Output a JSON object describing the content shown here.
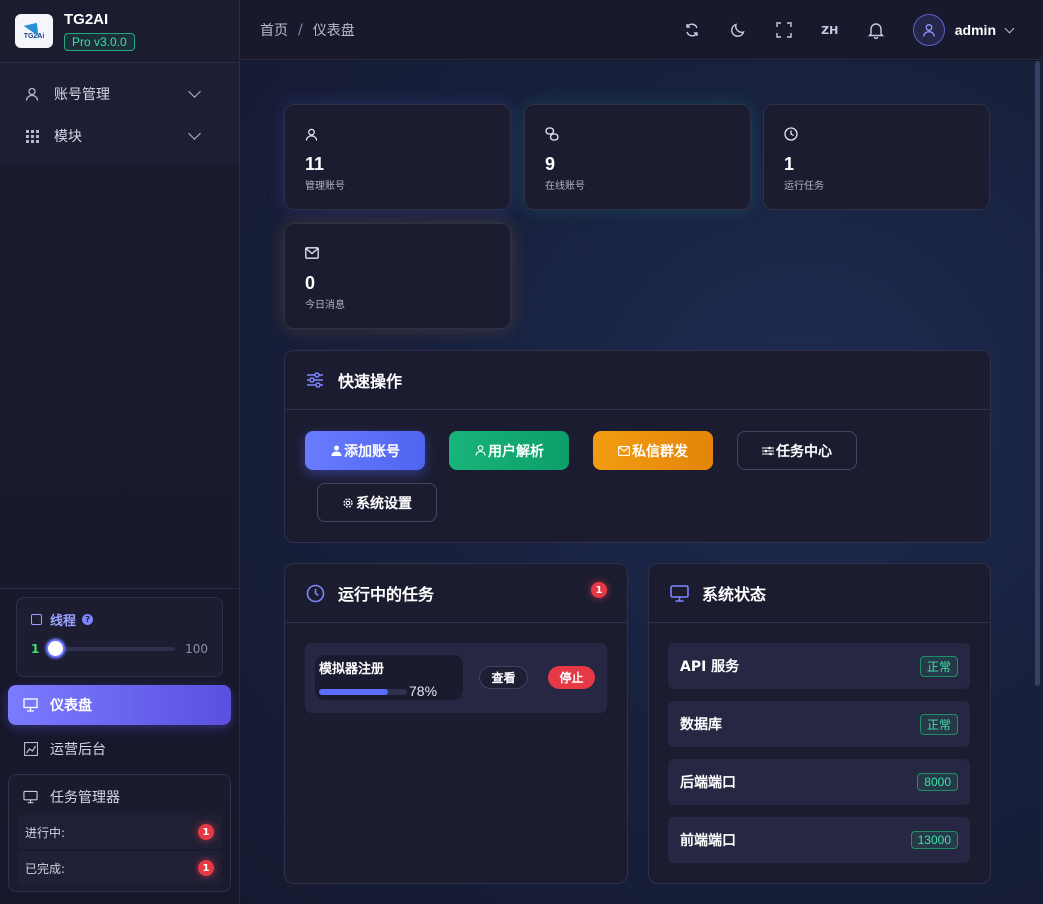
{
  "brand": {
    "logo_text": "TG2Ai",
    "title": "TG2AI",
    "version": "Pro v3.0.0"
  },
  "sidebar": {
    "menu": [
      {
        "label": "账号管理",
        "icon": "user-icon"
      },
      {
        "label": "模块",
        "icon": "grid-icon"
      }
    ],
    "thread": {
      "label": "线程",
      "help": "?",
      "min": "1",
      "max": "100",
      "value": 1
    },
    "nav": [
      {
        "label": "仪表盘",
        "icon": "presentation-icon",
        "active": true
      },
      {
        "label": "运营后台",
        "icon": "chart-icon",
        "active": false
      }
    ],
    "task_manager": {
      "title": "任务管理器",
      "rows": [
        {
          "label": "进行中:",
          "count": "1"
        },
        {
          "label": "已完成:",
          "count": "1"
        }
      ]
    }
  },
  "header": {
    "breadcrumb": [
      "首页",
      "仪表盘"
    ],
    "breadcrumb_sep": "/",
    "lang": "ZH",
    "username": "admin"
  },
  "stats": [
    {
      "value": "11",
      "label": "管理账号",
      "icon": "user-icon"
    },
    {
      "value": "9",
      "label": "在线账号",
      "icon": "link-icon"
    },
    {
      "value": "1",
      "label": "运行任务",
      "icon": "clock-icon"
    },
    {
      "value": "0",
      "label": "今日消息",
      "icon": "mail-icon"
    }
  ],
  "quick_actions": {
    "title": "快速操作",
    "buttons": [
      {
        "label": "添加账号",
        "icon": "user-add-icon"
      },
      {
        "label": "用户解析",
        "icon": "user-icon"
      },
      {
        "label": "私信群发",
        "icon": "mail-icon"
      },
      {
        "label": "任务中心",
        "icon": "sliders-icon"
      },
      {
        "label": "系统设置",
        "icon": "gear-icon"
      }
    ]
  },
  "running_tasks": {
    "title": "运行中的任务",
    "badge": "1",
    "items": [
      {
        "name": "模拟器注册",
        "progress": 0.78,
        "progress_text": "78%",
        "view_label": "查看",
        "stop_label": "停止"
      }
    ]
  },
  "system_status": {
    "title": "系统状态",
    "rows": [
      {
        "label": "API 服务",
        "value": "正常"
      },
      {
        "label": "数据库",
        "value": "正常"
      },
      {
        "label": "后端端口",
        "value": "8000"
      },
      {
        "label": "前端端口",
        "value": "13000"
      }
    ]
  },
  "colors": {
    "accent": "#5b6dff",
    "success": "#3ee0a7",
    "danger": "#e53946",
    "warning": "#f39c12",
    "green_button": "#18b47b"
  }
}
